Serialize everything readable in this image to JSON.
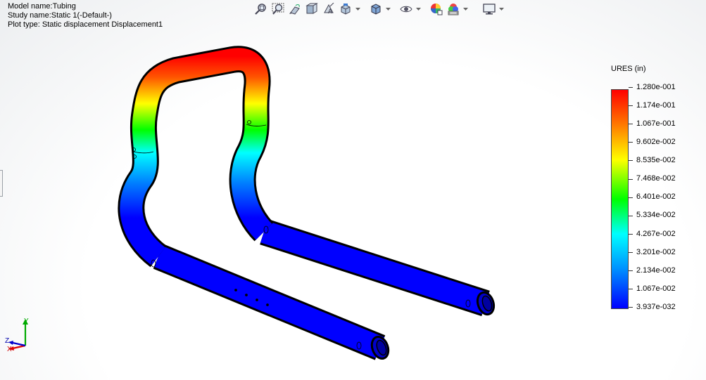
{
  "header": {
    "model_name": "Model name:Tubing",
    "study_name": "Study name:Static 1(-Default-)",
    "plot_type": "Plot type: Static displacement Displacement1"
  },
  "toolbar": {
    "buttons": [
      {
        "name": "zoom-to-fit-icon"
      },
      {
        "name": "zoom-to-area-icon"
      },
      {
        "name": "previous-view-icon"
      },
      {
        "name": "section-view-icon"
      },
      {
        "name": "dynamic-annotation-icon"
      },
      {
        "name": "view-orientation-icon",
        "dropdown": true
      },
      {
        "name": "display-style-icon",
        "dropdown": true
      },
      {
        "name": "hide-show-items-icon",
        "dropdown": true
      },
      {
        "name": "edit-appearance-icon"
      },
      {
        "name": "apply-scene-icon",
        "dropdown": true
      },
      {
        "name": "view-settings-icon",
        "dropdown": true
      }
    ]
  },
  "legend": {
    "title": "URES (in)",
    "labels": [
      "1.280e-001",
      "1.174e-001",
      "1.067e-001",
      "9.602e-002",
      "8.535e-002",
      "7.468e-002",
      "6.401e-002",
      "5.334e-002",
      "4.267e-002",
      "3.201e-002",
      "2.134e-002",
      "1.067e-002",
      "3.937e-032"
    ],
    "colors": [
      "#ff0000",
      "#ff7a00",
      "#ffff00",
      "#00ff00",
      "#00ffff",
      "#0090ff",
      "#0000ff"
    ]
  },
  "triad": {
    "x": "X",
    "y": "Y",
    "z": "Z"
  }
}
